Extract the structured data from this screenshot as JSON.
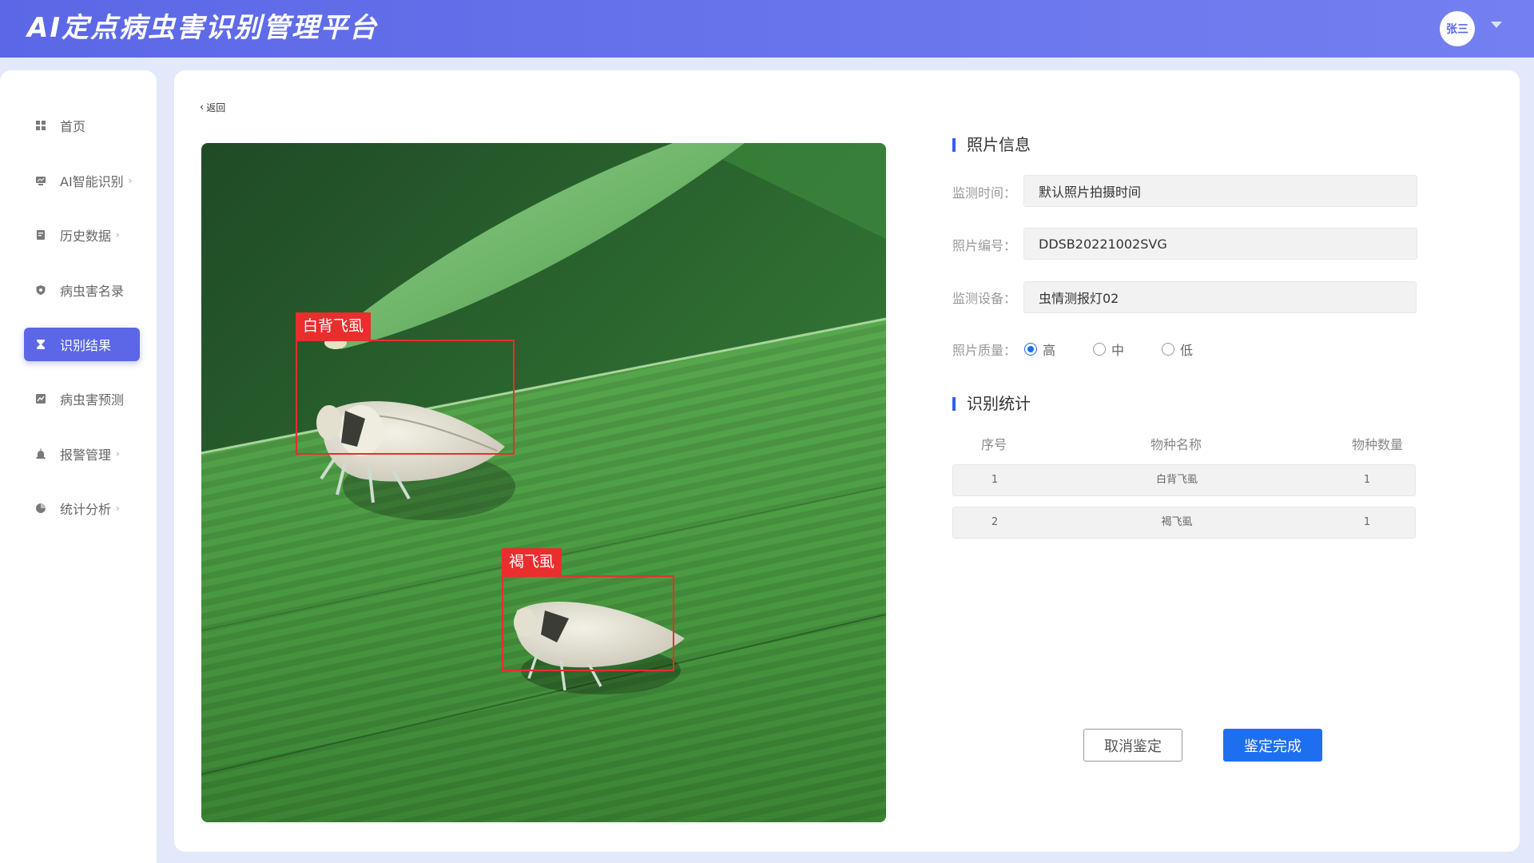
{
  "app": {
    "title": "AI定点病虫害识别管理平台",
    "user_avatar_text": "张三"
  },
  "sidebar": {
    "items": [
      {
        "label": "首页",
        "has_chevron": false,
        "active": false,
        "icon": "grid-icon"
      },
      {
        "label": "AI智能识别",
        "has_chevron": true,
        "active": false,
        "icon": "monitor-icon"
      },
      {
        "label": "历史数据",
        "has_chevron": true,
        "active": false,
        "icon": "document-icon"
      },
      {
        "label": "病虫害名录",
        "has_chevron": false,
        "active": false,
        "icon": "shield-icon"
      },
      {
        "label": "识别结果",
        "has_chevron": false,
        "active": true,
        "icon": "hourglass-icon"
      },
      {
        "label": "病虫害预测",
        "has_chevron": false,
        "active": false,
        "icon": "chart-icon"
      },
      {
        "label": "报警管理",
        "has_chevron": true,
        "active": false,
        "icon": "alarm-icon"
      },
      {
        "label": "统计分析",
        "has_chevron": true,
        "active": false,
        "icon": "pie-icon"
      }
    ],
    "chevron_glyph": "›"
  },
  "main": {
    "back_label": "返回",
    "back_arrow_glyph": "‹",
    "detections": [
      {
        "label": "白背飞虱"
      },
      {
        "label": "褐飞虱"
      }
    ],
    "photo_info": {
      "title": "照片信息",
      "fields": [
        {
          "label": "监测时间：",
          "value": "默认照片拍摄时间"
        },
        {
          "label": "照片编号：",
          "value": "DDSB20221002SVG"
        },
        {
          "label": "监测设备：",
          "value": "虫情测报灯02"
        }
      ],
      "quality": {
        "label": "照片质量：",
        "options": [
          "高",
          "中",
          "低"
        ],
        "selected": "高"
      }
    },
    "stats": {
      "title": "识别统计",
      "columns": [
        "序号",
        "物种名称",
        "物种数量"
      ],
      "rows": [
        {
          "index": "1",
          "name": "白背飞虱",
          "count": "1"
        },
        {
          "index": "2",
          "name": "褐飞虱",
          "count": "1"
        }
      ]
    },
    "buttons": {
      "cancel": "取消鉴定",
      "confirm": "鉴定完成"
    }
  },
  "colors": {
    "header_gradient_start": "#5b67e6",
    "header_gradient_end": "#7480f0",
    "accent": "#1e6ff0",
    "sidebar_active": "#5b67e6",
    "detection_red": "#ea2d2d",
    "section_marker": "#3460e6"
  }
}
